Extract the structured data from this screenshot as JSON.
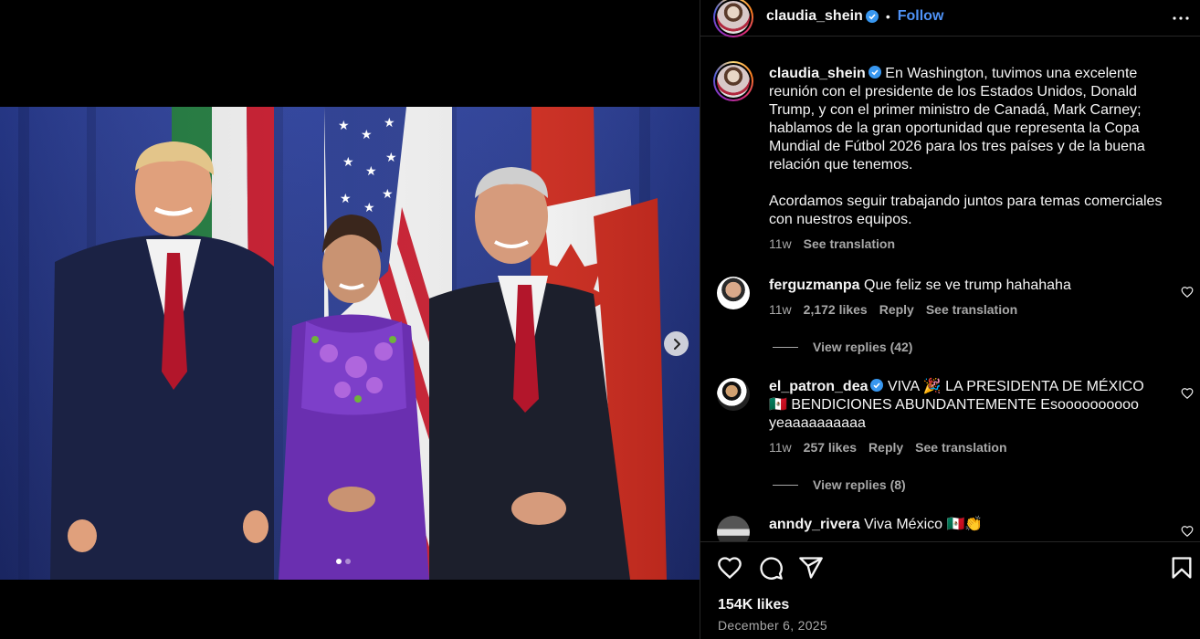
{
  "post": {
    "username": "claudia_shein",
    "follow_label": "Follow",
    "separator": "•",
    "verified": true,
    "media": {
      "slide_count": 2,
      "active_slide": 1,
      "flags": [
        "Mexico",
        "United States",
        "Canada"
      ]
    }
  },
  "caption": {
    "username": "claudia_shein",
    "paragraph1": "En Washington, tuvimos una excelente reunión con el presidente de los Estados Unidos, Donald Trump, y con el primer ministro de Canadá, Mark Carney; hablamos de la gran oportunidad que representa la Copa Mundial de Fútbol 2026 para los tres países y de la buena relación que tenemos.",
    "paragraph2": "Acordamos seguir trabajando juntos para temas comerciales con nuestros equipos.",
    "time": "11w",
    "see_translation": "See translation"
  },
  "comments": [
    {
      "username": "ferguzmanpa",
      "verified": false,
      "text": "Que feliz se ve trump hahahaha",
      "time": "11w",
      "likes": "2,172 likes",
      "reply": "Reply",
      "see_translation": "See translation",
      "view_replies": "View replies (42)"
    },
    {
      "username": "el_patron_dea",
      "verified": true,
      "text": "VIVA 🎉 LA PRESIDENTA DE MÉXICO 🇲🇽 BENDICIONES ABUNDANTEMENTE Esoooooooooo yeaaaaaaaaaa",
      "time": "11w",
      "likes": "257 likes",
      "reply": "Reply",
      "see_translation": "See translation",
      "view_replies": "View replies (8)"
    },
    {
      "username": "anndy_rivera",
      "verified": false,
      "text": "Viva México 🇲🇽👏"
    }
  ],
  "actions": {
    "likes": "154K likes",
    "date": "December 6, 2025",
    "icons": [
      "heart-icon",
      "comment-icon",
      "share-icon",
      "bookmark-icon"
    ]
  },
  "colors": {
    "background": "#000000",
    "link_blue": "#4f92f6",
    "secondary_text": "#a8a8a8",
    "verified_blue": "#3897f0"
  }
}
